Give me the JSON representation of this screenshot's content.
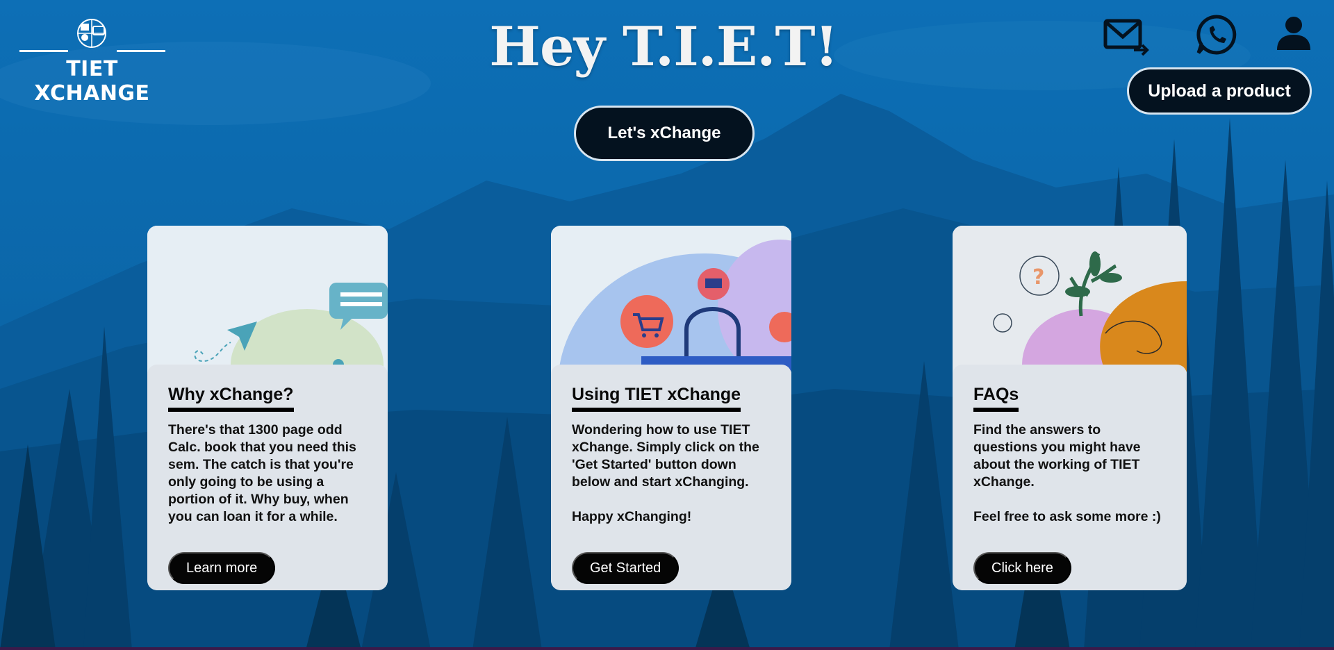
{
  "brand": {
    "name": "TIET XCHANGE"
  },
  "hero": {
    "title": "Hey T.I.E.T!",
    "cta_label": "Let's xChange"
  },
  "header": {
    "upload_label": "Upload a product",
    "icons": [
      "mail-forward-icon",
      "whatsapp-icon",
      "user-icon"
    ]
  },
  "cards": [
    {
      "title": "Why xChange?",
      "text": "There's that 1300 page odd Calc. book that you need this sem. The catch is that you're only going to be using a portion of it. Why buy, when you can loan it for a while.",
      "button": "Learn more"
    },
    {
      "title": "Using TIET xChange",
      "text": "Wondering how to use TIET xChange. Simply click on the 'Get Started' button down below and start xChanging.\n\nHappy xChanging!",
      "button": "Get Started"
    },
    {
      "title": "FAQs",
      "text": "Find the answers to questions you might have about the working of TIET xChange.\n\nFeel free to ask some more :)",
      "button": "Click here"
    }
  ],
  "colors": {
    "sky": "#0f6fb4",
    "forest": "#053a63",
    "button_dark": "#04121f",
    "card_bg": "#dfe4ea"
  }
}
